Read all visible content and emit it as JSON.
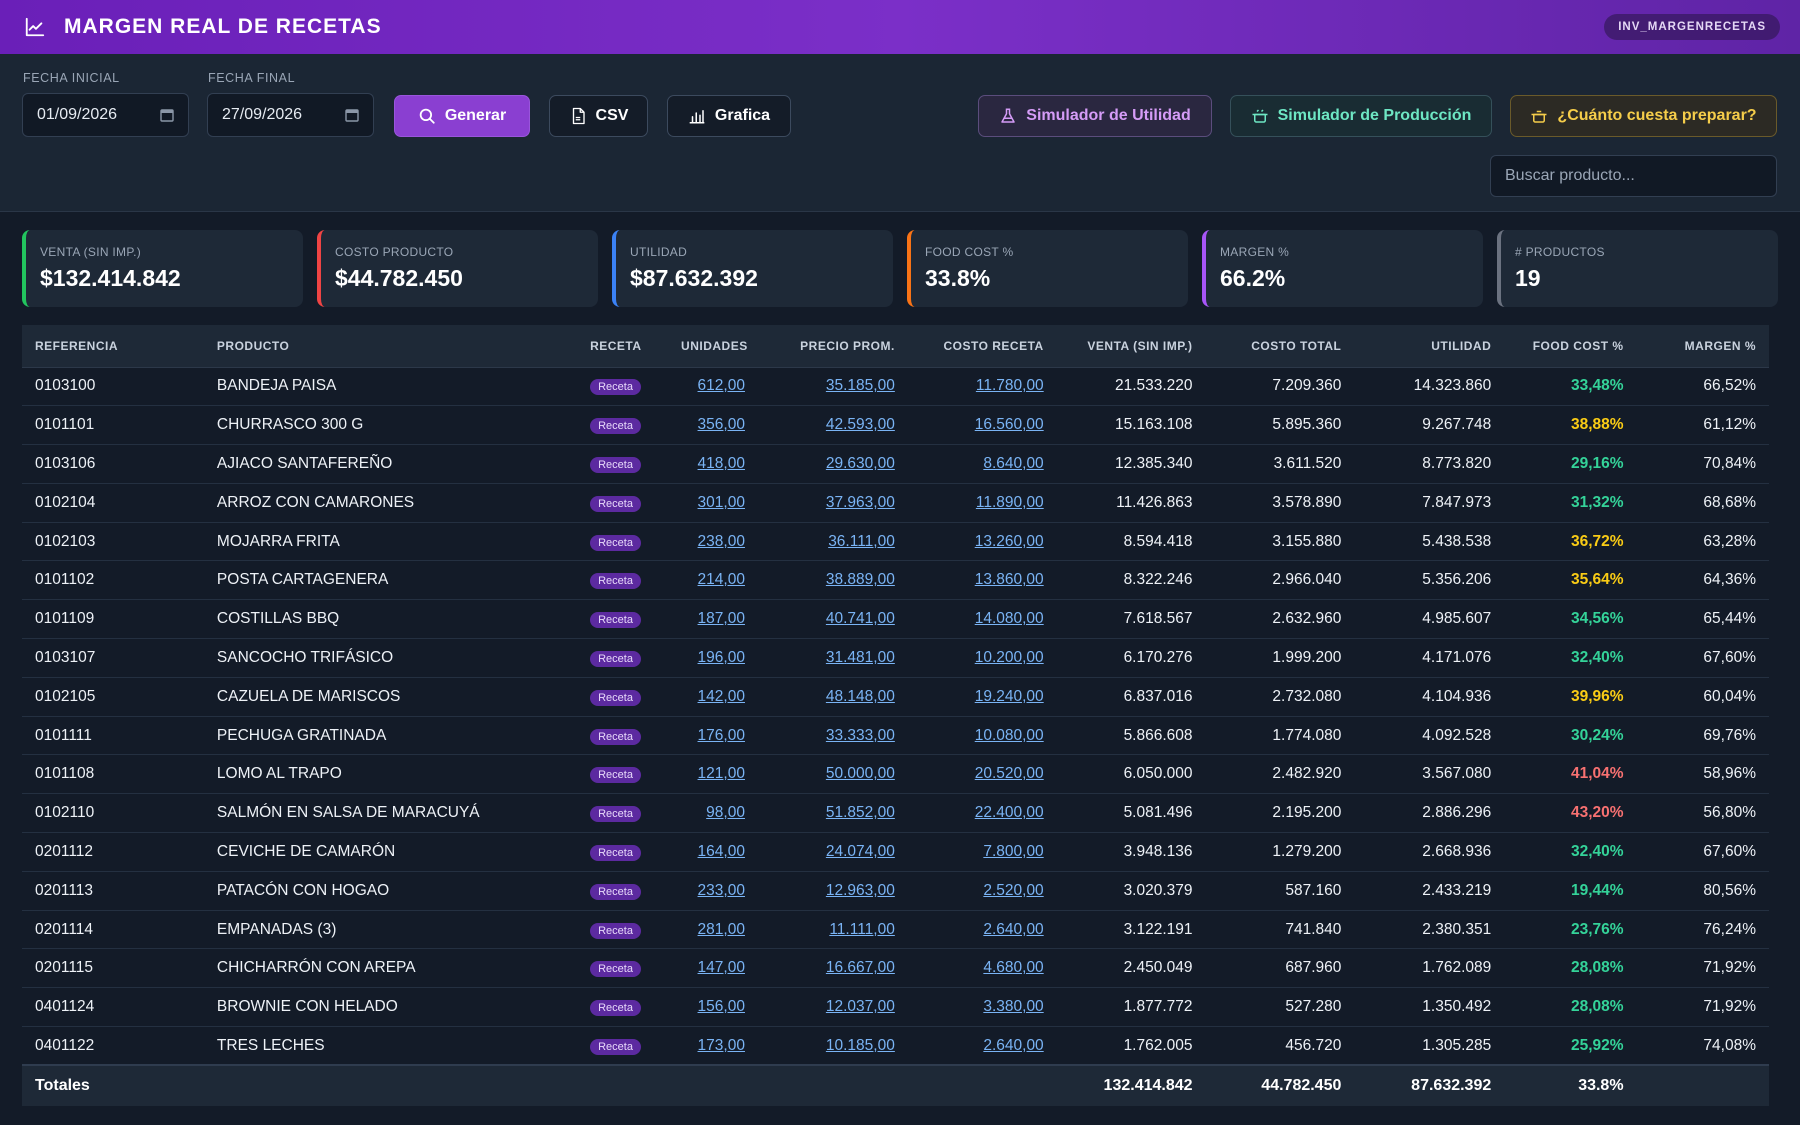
{
  "header": {
    "title": "MARGEN REAL DE RECETAS",
    "badge": "INV_MARGENRECETAS"
  },
  "filters": {
    "start_label": "FECHA INICIAL",
    "start_value": "01/09/2026",
    "end_label": "FECHA FINAL",
    "end_value": "27/09/2026",
    "generate_label": "Generar",
    "csv_label": "CSV",
    "chart_label": "Grafica",
    "sim_utilidad_label": "Simulador de Utilidad",
    "sim_produccion_label": "Simulador de Producción",
    "cuanto_label": "¿Cuánto cuesta preparar?",
    "search_placeholder": "Buscar producto..."
  },
  "kpis": [
    {
      "label": "VENTA (SIN IMP.)",
      "value": "$132.414.842",
      "color": "#22c55e"
    },
    {
      "label": "COSTO PRODUCTO",
      "value": "$44.782.450",
      "color": "#ef4444"
    },
    {
      "label": "UTILIDAD",
      "value": "$87.632.392",
      "color": "#3b82f6"
    },
    {
      "label": "FOOD COST %",
      "value": "33.8%",
      "color": "#f97316"
    },
    {
      "label": "MARGEN %",
      "value": "66.2%",
      "color": "#a855f7"
    },
    {
      "label": "# PRODUCTOS",
      "value": "19",
      "color": "#6b7280"
    }
  ],
  "colors": {
    "fc_green": "#34d399",
    "fc_yellow": "#facc15",
    "fc_red": "#f87171"
  },
  "table": {
    "headers": [
      "REFERENCIA",
      "PRODUCTO",
      "RECETA",
      "UNIDADES",
      "PRECIO PROM.",
      "COSTO RECETA",
      "VENTA (SIN IMP.)",
      "COSTO TOTAL",
      "UTILIDAD",
      "FOOD COST %",
      "MARGEN %"
    ],
    "rows": [
      {
        "ref": "0103100",
        "producto": "BANDEJA PAISA",
        "receta": "Receta",
        "unidades": "612,00",
        "precio": "35.185,00",
        "costo_receta": "11.780,00",
        "venta": "21.533.220",
        "costo_total": "7.209.360",
        "utilidad": "14.323.860",
        "food_cost": "33,48%",
        "fc_level": "green",
        "margen": "66,52%"
      },
      {
        "ref": "0101101",
        "producto": "CHURRASCO 300 G",
        "receta": "Receta",
        "unidades": "356,00",
        "precio": "42.593,00",
        "costo_receta": "16.560,00",
        "venta": "15.163.108",
        "costo_total": "5.895.360",
        "utilidad": "9.267.748",
        "food_cost": "38,88%",
        "fc_level": "yellow",
        "margen": "61,12%"
      },
      {
        "ref": "0103106",
        "producto": "AJIACO SANTAFEREÑO",
        "receta": "Receta",
        "unidades": "418,00",
        "precio": "29.630,00",
        "costo_receta": "8.640,00",
        "venta": "12.385.340",
        "costo_total": "3.611.520",
        "utilidad": "8.773.820",
        "food_cost": "29,16%",
        "fc_level": "green",
        "margen": "70,84%"
      },
      {
        "ref": "0102104",
        "producto": "ARROZ CON CAMARONES",
        "receta": "Receta",
        "unidades": "301,00",
        "precio": "37.963,00",
        "costo_receta": "11.890,00",
        "venta": "11.426.863",
        "costo_total": "3.578.890",
        "utilidad": "7.847.973",
        "food_cost": "31,32%",
        "fc_level": "green",
        "margen": "68,68%"
      },
      {
        "ref": "0102103",
        "producto": "MOJARRA FRITA",
        "receta": "Receta",
        "unidades": "238,00",
        "precio": "36.111,00",
        "costo_receta": "13.260,00",
        "venta": "8.594.418",
        "costo_total": "3.155.880",
        "utilidad": "5.438.538",
        "food_cost": "36,72%",
        "fc_level": "yellow",
        "margen": "63,28%"
      },
      {
        "ref": "0101102",
        "producto": "POSTA CARTAGENERA",
        "receta": "Receta",
        "unidades": "214,00",
        "precio": "38.889,00",
        "costo_receta": "13.860,00",
        "venta": "8.322.246",
        "costo_total": "2.966.040",
        "utilidad": "5.356.206",
        "food_cost": "35,64%",
        "fc_level": "yellow",
        "margen": "64,36%"
      },
      {
        "ref": "0101109",
        "producto": "COSTILLAS BBQ",
        "receta": "Receta",
        "unidades": "187,00",
        "precio": "40.741,00",
        "costo_receta": "14.080,00",
        "venta": "7.618.567",
        "costo_total": "2.632.960",
        "utilidad": "4.985.607",
        "food_cost": "34,56%",
        "fc_level": "green",
        "margen": "65,44%"
      },
      {
        "ref": "0103107",
        "producto": "SANCOCHO TRIFÁSICO",
        "receta": "Receta",
        "unidades": "196,00",
        "precio": "31.481,00",
        "costo_receta": "10.200,00",
        "venta": "6.170.276",
        "costo_total": "1.999.200",
        "utilidad": "4.171.076",
        "food_cost": "32,40%",
        "fc_level": "green",
        "margen": "67,60%"
      },
      {
        "ref": "0102105",
        "producto": "CAZUELA DE MARISCOS",
        "receta": "Receta",
        "unidades": "142,00",
        "precio": "48.148,00",
        "costo_receta": "19.240,00",
        "venta": "6.837.016",
        "costo_total": "2.732.080",
        "utilidad": "4.104.936",
        "food_cost": "39,96%",
        "fc_level": "yellow",
        "margen": "60,04%"
      },
      {
        "ref": "0101111",
        "producto": "PECHUGA GRATINADA",
        "receta": "Receta",
        "unidades": "176,00",
        "precio": "33.333,00",
        "costo_receta": "10.080,00",
        "venta": "5.866.608",
        "costo_total": "1.774.080",
        "utilidad": "4.092.528",
        "food_cost": "30,24%",
        "fc_level": "green",
        "margen": "69,76%"
      },
      {
        "ref": "0101108",
        "producto": "LOMO AL TRAPO",
        "receta": "Receta",
        "unidades": "121,00",
        "precio": "50.000,00",
        "costo_receta": "20.520,00",
        "venta": "6.050.000",
        "costo_total": "2.482.920",
        "utilidad": "3.567.080",
        "food_cost": "41,04%",
        "fc_level": "red",
        "margen": "58,96%"
      },
      {
        "ref": "0102110",
        "producto": "SALMÓN EN SALSA DE MARACUYÁ",
        "receta": "Receta",
        "unidades": "98,00",
        "precio": "51.852,00",
        "costo_receta": "22.400,00",
        "venta": "5.081.496",
        "costo_total": "2.195.200",
        "utilidad": "2.886.296",
        "food_cost": "43,20%",
        "fc_level": "red",
        "margen": "56,80%"
      },
      {
        "ref": "0201112",
        "producto": "CEVICHE DE CAMARÓN",
        "receta": "Receta",
        "unidades": "164,00",
        "precio": "24.074,00",
        "costo_receta": "7.800,00",
        "venta": "3.948.136",
        "costo_total": "1.279.200",
        "utilidad": "2.668.936",
        "food_cost": "32,40%",
        "fc_level": "green",
        "margen": "67,60%"
      },
      {
        "ref": "0201113",
        "producto": "PATACÓN CON HOGAO",
        "receta": "Receta",
        "unidades": "233,00",
        "precio": "12.963,00",
        "costo_receta": "2.520,00",
        "venta": "3.020.379",
        "costo_total": "587.160",
        "utilidad": "2.433.219",
        "food_cost": "19,44%",
        "fc_level": "green",
        "margen": "80,56%"
      },
      {
        "ref": "0201114",
        "producto": "EMPANADAS (3)",
        "receta": "Receta",
        "unidades": "281,00",
        "precio": "11.111,00",
        "costo_receta": "2.640,00",
        "venta": "3.122.191",
        "costo_total": "741.840",
        "utilidad": "2.380.351",
        "food_cost": "23,76%",
        "fc_level": "green",
        "margen": "76,24%"
      },
      {
        "ref": "0201115",
        "producto": "CHICHARRÓN CON AREPA",
        "receta": "Receta",
        "unidades": "147,00",
        "precio": "16.667,00",
        "costo_receta": "4.680,00",
        "venta": "2.450.049",
        "costo_total": "687.960",
        "utilidad": "1.762.089",
        "food_cost": "28,08%",
        "fc_level": "green",
        "margen": "71,92%"
      },
      {
        "ref": "0401124",
        "producto": "BROWNIE CON HELADO",
        "receta": "Receta",
        "unidades": "156,00",
        "precio": "12.037,00",
        "costo_receta": "3.380,00",
        "venta": "1.877.772",
        "costo_total": "527.280",
        "utilidad": "1.350.492",
        "food_cost": "28,08%",
        "fc_level": "green",
        "margen": "71,92%"
      },
      {
        "ref": "0401122",
        "producto": "TRES LECHES",
        "receta": "Receta",
        "unidades": "173,00",
        "precio": "10.185,00",
        "costo_receta": "2.640,00",
        "venta": "1.762.005",
        "costo_total": "456.720",
        "utilidad": "1.305.285",
        "food_cost": "25,92%",
        "fc_level": "green",
        "margen": "74,08%"
      }
    ],
    "totals": {
      "label": "Totales",
      "venta": "132.414.842",
      "costo_total": "44.782.450",
      "utilidad": "87.632.392",
      "food_cost": "33.8%"
    }
  }
}
